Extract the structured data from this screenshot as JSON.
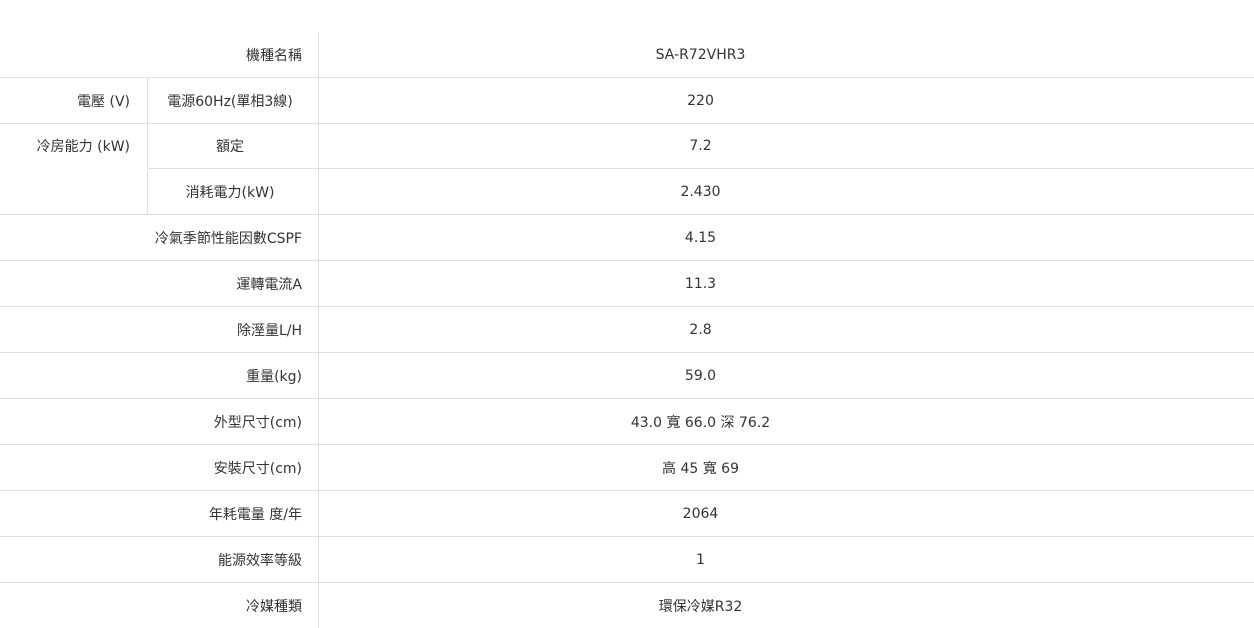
{
  "spec": {
    "model_label": "機種名稱",
    "model_value": "SA-R72VHR3",
    "voltage_label": "電壓 (V)",
    "voltage_sub_label": "電源60Hz(單相3線)",
    "voltage_value": "220",
    "cooling_label": "冷房能力 (kW)",
    "cooling_rated_label": "額定",
    "cooling_rated_value": "7.2",
    "cooling_power_label": "消耗電力(kW)",
    "cooling_power_value": "2.430",
    "cspf_label": "冷氣季節性能因數CSPF",
    "cspf_value": "4.15",
    "current_label": "運轉電流A",
    "current_value": "11.3",
    "dehumid_label": "除溼量L/H",
    "dehumid_value": "2.8",
    "weight_label": "重量(kg)",
    "weight_value": "59.0",
    "dimension_label": "外型尺寸(cm)",
    "dimension_value": "43.0 寬 66.0 深 76.2",
    "install_label": "安裝尺寸(cm)",
    "install_value": "高 45 寬 69",
    "annual_label": "年耗電量 度/年",
    "annual_value": "2064",
    "efficiency_label": "能源效率等級",
    "efficiency_value": "1",
    "refrigerant_label": "冷媒種類",
    "refrigerant_value": "環保冷媒R32"
  }
}
